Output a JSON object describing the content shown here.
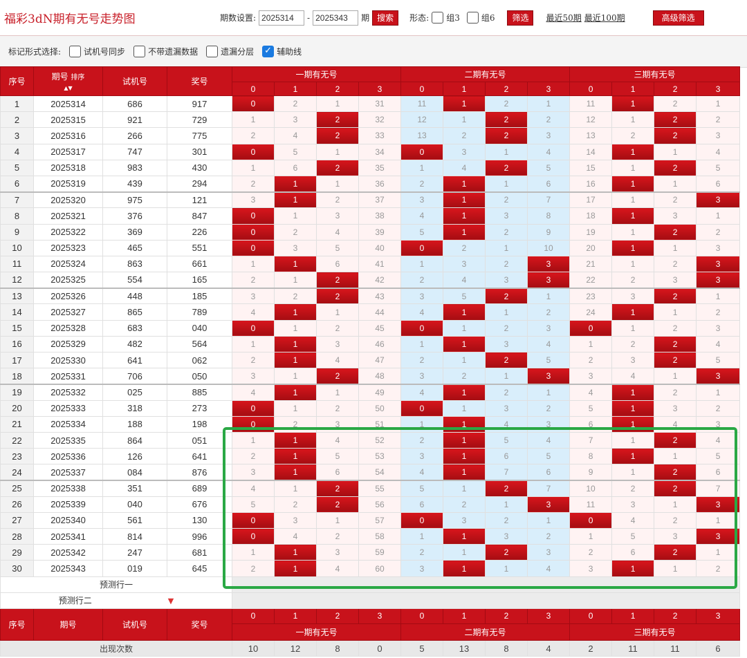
{
  "app": {
    "title": "福彩3dN期有无号走势图"
  },
  "query": {
    "period_label": "期数设置:",
    "start": "2025314",
    "end": "2025343",
    "qi": "期",
    "search": "搜索",
    "form_label": "形态:",
    "z3": "组3",
    "z6": "组6",
    "filter": "筛选",
    "recent50": "最近50期",
    "recent100": "最近100期",
    "advanced": "高级筛选"
  },
  "mark": {
    "label": "标记形式选择:",
    "opt1": "试机号同步",
    "opt2": "不带遗漏数据",
    "opt3": "遗漏分层",
    "opt4": "辅助线",
    "opt4_checked": true
  },
  "headers": {
    "seq": "序号",
    "period": "期号",
    "sort": "排序",
    "sort_arrow": "▲▼",
    "trial": "试机号",
    "prize": "奖号",
    "group1": "一期有无号",
    "group2": "二期有无号",
    "group3": "三期有无号",
    "digits": [
      "0",
      "1",
      "2",
      "3"
    ]
  },
  "rows": [
    [
      "1",
      "2025314",
      "686",
      "917",
      "0",
      "2",
      "1",
      "31",
      "11",
      "1",
      "2",
      "1",
      "11",
      "1",
      "2",
      "1"
    ],
    [
      "2",
      "2025315",
      "921",
      "729",
      "1",
      "3",
      "2",
      "32",
      "12",
      "1",
      "2",
      "2",
      "12",
      "1",
      "2",
      "2"
    ],
    [
      "3",
      "2025316",
      "266",
      "775",
      "2",
      "4",
      "2",
      "33",
      "13",
      "2",
      "2",
      "3",
      "13",
      "2",
      "2",
      "3"
    ],
    [
      "4",
      "2025317",
      "747",
      "301",
      "0",
      "5",
      "1",
      "34",
      "0",
      "3",
      "1",
      "4",
      "14",
      "1",
      "1",
      "4"
    ],
    [
      "5",
      "2025318",
      "983",
      "430",
      "1",
      "6",
      "2",
      "35",
      "1",
      "4",
      "2",
      "5",
      "15",
      "1",
      "2",
      "5"
    ],
    [
      "6",
      "2025319",
      "439",
      "294",
      "2",
      "1",
      "1",
      "36",
      "2",
      "1",
      "1",
      "6",
      "16",
      "1",
      "1",
      "6"
    ],
    [
      "7",
      "2025320",
      "975",
      "121",
      "3",
      "1",
      "2",
      "37",
      "3",
      "1",
      "2",
      "7",
      "17",
      "1",
      "2",
      "3"
    ],
    [
      "8",
      "2025321",
      "376",
      "847",
      "0",
      "1",
      "3",
      "38",
      "4",
      "1",
      "3",
      "8",
      "18",
      "1",
      "3",
      "1"
    ],
    [
      "9",
      "2025322",
      "369",
      "226",
      "0",
      "2",
      "4",
      "39",
      "5",
      "1",
      "2",
      "9",
      "19",
      "1",
      "2",
      "2"
    ],
    [
      "10",
      "2025323",
      "465",
      "551",
      "0",
      "3",
      "5",
      "40",
      "0",
      "2",
      "1",
      "10",
      "20",
      "1",
      "1",
      "3"
    ],
    [
      "11",
      "2025324",
      "863",
      "661",
      "1",
      "1",
      "6",
      "41",
      "1",
      "3",
      "2",
      "3",
      "21",
      "1",
      "2",
      "3"
    ],
    [
      "12",
      "2025325",
      "554",
      "165",
      "2",
      "1",
      "2",
      "42",
      "2",
      "4",
      "3",
      "3",
      "22",
      "2",
      "3",
      "3"
    ],
    [
      "13",
      "2025326",
      "448",
      "185",
      "3",
      "2",
      "2",
      "43",
      "3",
      "5",
      "2",
      "1",
      "23",
      "3",
      "2",
      "1"
    ],
    [
      "14",
      "2025327",
      "865",
      "789",
      "4",
      "1",
      "1",
      "44",
      "4",
      "1",
      "1",
      "2",
      "24",
      "1",
      "1",
      "2"
    ],
    [
      "15",
      "2025328",
      "683",
      "040",
      "0",
      "1",
      "2",
      "45",
      "0",
      "1",
      "2",
      "3",
      "0",
      "1",
      "2",
      "3"
    ],
    [
      "16",
      "2025329",
      "482",
      "564",
      "1",
      "1",
      "3",
      "46",
      "1",
      "1",
      "3",
      "4",
      "1",
      "2",
      "2",
      "4"
    ],
    [
      "17",
      "2025330",
      "641",
      "062",
      "2",
      "1",
      "4",
      "47",
      "2",
      "1",
      "2",
      "5",
      "2",
      "3",
      "2",
      "5"
    ],
    [
      "18",
      "2025331",
      "706",
      "050",
      "3",
      "1",
      "2",
      "48",
      "3",
      "2",
      "1",
      "3",
      "3",
      "4",
      "1",
      "3"
    ],
    [
      "19",
      "2025332",
      "025",
      "885",
      "4",
      "1",
      "1",
      "49",
      "4",
      "1",
      "2",
      "1",
      "4",
      "1",
      "2",
      "1"
    ],
    [
      "20",
      "2025333",
      "318",
      "273",
      "0",
      "1",
      "2",
      "50",
      "0",
      "1",
      "3",
      "2",
      "5",
      "1",
      "3",
      "2"
    ],
    [
      "21",
      "2025334",
      "188",
      "198",
      "0",
      "2",
      "3",
      "51",
      "1",
      "1",
      "4",
      "3",
      "6",
      "1",
      "4",
      "3"
    ],
    [
      "22",
      "2025335",
      "864",
      "051",
      "1",
      "1",
      "4",
      "52",
      "2",
      "1",
      "5",
      "4",
      "7",
      "1",
      "2",
      "4"
    ],
    [
      "23",
      "2025336",
      "126",
      "641",
      "2",
      "1",
      "5",
      "53",
      "3",
      "1",
      "6",
      "5",
      "8",
      "1",
      "1",
      "5"
    ],
    [
      "24",
      "2025337",
      "084",
      "876",
      "3",
      "1",
      "6",
      "54",
      "4",
      "1",
      "7",
      "6",
      "9",
      "1",
      "2",
      "6"
    ],
    [
      "25",
      "2025338",
      "351",
      "689",
      "4",
      "1",
      "2",
      "55",
      "5",
      "1",
      "2",
      "7",
      "10",
      "2",
      "2",
      "7"
    ],
    [
      "26",
      "2025339",
      "040",
      "676",
      "5",
      "2",
      "2",
      "56",
      "6",
      "2",
      "1",
      "3",
      "11",
      "3",
      "1",
      "3"
    ],
    [
      "27",
      "2025340",
      "561",
      "130",
      "0",
      "3",
      "1",
      "57",
      "0",
      "3",
      "2",
      "1",
      "0",
      "4",
      "2",
      "1"
    ],
    [
      "28",
      "2025341",
      "814",
      "996",
      "0",
      "4",
      "2",
      "58",
      "1",
      "1",
      "3",
      "2",
      "1",
      "5",
      "3",
      "3"
    ],
    [
      "29",
      "2025342",
      "247",
      "681",
      "1",
      "1",
      "3",
      "59",
      "2",
      "1",
      "2",
      "3",
      "2",
      "6",
      "2",
      "1"
    ],
    [
      "30",
      "2025343",
      "019",
      "645",
      "2",
      "1",
      "4",
      "60",
      "3",
      "1",
      "1",
      "4",
      "3",
      "1",
      "1",
      "2"
    ]
  ],
  "predict": {
    "row1": "预测行一",
    "row2": "预测行二",
    "arrow": "▼"
  },
  "footer": {
    "label": "出现次数",
    "counts": [
      "10",
      "12",
      "8",
      "0",
      "5",
      "13",
      "8",
      "4",
      "2",
      "11",
      "11",
      "6"
    ]
  }
}
